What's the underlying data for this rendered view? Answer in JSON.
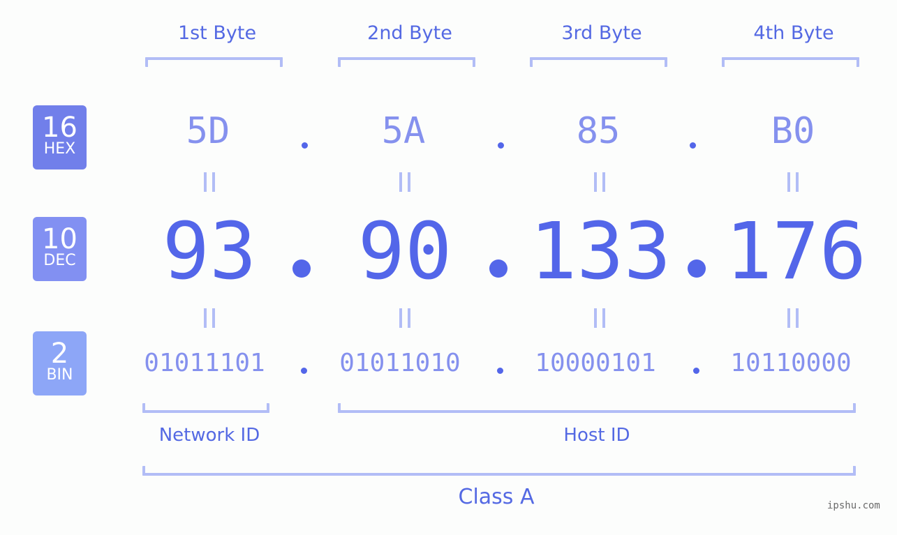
{
  "ip": {
    "dotted_decimal": "93.90.133.176",
    "class": "Class A"
  },
  "byte_headers": [
    "1st Byte",
    "2nd Byte",
    "3rd Byte",
    "4th Byte"
  ],
  "rows": {
    "hex": {
      "base": "16",
      "label": "HEX",
      "values": [
        "5D",
        "5A",
        "85",
        "B0"
      ],
      "badge_color": "#717fea"
    },
    "dec": {
      "base": "10",
      "label": "DEC",
      "values": [
        "93",
        "90",
        "133",
        "176"
      ],
      "badge_color": "#8290f2"
    },
    "bin": {
      "base": "2",
      "label": "BIN",
      "values": [
        "01011101",
        "01011010",
        "10000101",
        "10110000"
      ],
      "badge_color": "#8da6f7"
    }
  },
  "separator": ".",
  "segments": {
    "network_id": "Network ID",
    "host_id": "Host ID",
    "class_label": "Class A"
  },
  "colors": {
    "accent": "#5366e9",
    "light_accent": "#8591ee",
    "bracket": "#b2bdf6",
    "background": "#fcfdfc"
  },
  "watermark": "ipshu.com"
}
